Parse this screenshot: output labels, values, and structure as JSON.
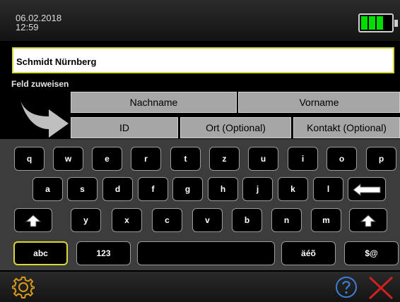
{
  "status": {
    "date": "06.02.2018",
    "time": "12:59",
    "battery_level": 0.75,
    "battery_color": "#00e000"
  },
  "input": {
    "value": "Schmidt Nürnberg"
  },
  "assign_label": "Feld zuweisen",
  "fields": {
    "nachname": "Nachname",
    "vorname": "Vorname",
    "id": "ID",
    "ort": "Ort (Optional)",
    "kontakt": "Kontakt (Optional)"
  },
  "keyboard": {
    "row1": [
      "q",
      "w",
      "e",
      "r",
      "t",
      "z",
      "u",
      "i",
      "o",
      "p"
    ],
    "row2": [
      "a",
      "s",
      "d",
      "f",
      "g",
      "h",
      "j",
      "k",
      "l"
    ],
    "row3": [
      "y",
      "x",
      "c",
      "v",
      "b",
      "n",
      "m"
    ],
    "abc": "abc",
    "num": "123",
    "accents": "äéõ",
    "symbols": "$@"
  },
  "icons": {
    "back_arrow": "arrow-right-curved-icon",
    "backspace": "backspace-icon",
    "shift": "shift-icon",
    "settings": "gear-icon",
    "help": "help-icon",
    "close": "close-icon"
  },
  "colors": {
    "accent": "#d7d736",
    "close_red": "#d02020",
    "help_blue": "#3d7fd8"
  }
}
